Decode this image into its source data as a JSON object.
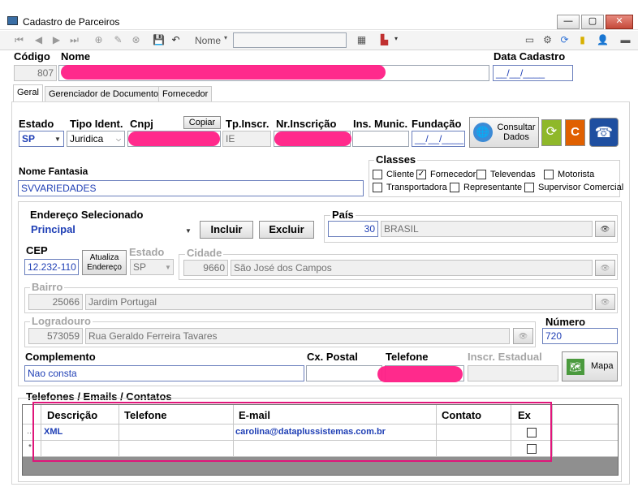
{
  "window": {
    "title": "Cadastro de Parceiros",
    "buttons": [
      "—",
      "▢",
      "✕"
    ]
  },
  "toolbar": {
    "nome_label": "Nome",
    "search_value": ""
  },
  "header": {
    "codigo_label": "Código",
    "codigo_value": "807",
    "nome_label": "Nome",
    "nome_value": "",
    "data_cadastro_label": "Data Cadastro",
    "data_cadastro_value": "__/__/____"
  },
  "tabs": [
    "Geral",
    "Gerenciador de Documentos",
    "Fornecedor"
  ],
  "geral": {
    "estado_label": "Estado",
    "estado_value": "SP",
    "tipo_ident_label": "Tipo Ident.",
    "tipo_ident_value": "Juridica",
    "cnpj_label": "Cnpj",
    "copiar_label": "Copiar",
    "tp_inscr_label": "Tp.Inscr.",
    "tp_inscr_value": "IE",
    "nr_inscricao_label": "Nr.Inscrição",
    "ins_munic_label": "Ins. Munic.",
    "fundacao_label": "Fundação",
    "fundacao_value": "__/__/____",
    "consultar_dados_label": "Consultar Dados",
    "nome_fantasia_label": "Nome Fantasia",
    "nome_fantasia_value": "SVVARIEDADES"
  },
  "classes": {
    "title": "Classes",
    "items": [
      {
        "label": "Cliente",
        "checked": false
      },
      {
        "label": "Fornecedor",
        "checked": true
      },
      {
        "label": "Televendas",
        "checked": false
      },
      {
        "label": "Motorista",
        "checked": false
      },
      {
        "label": "Transportadora",
        "checked": false
      },
      {
        "label": "Representante",
        "checked": false
      },
      {
        "label": "Supervisor Comercial",
        "checked": false
      }
    ]
  },
  "endereco": {
    "selecionado_label": "Endereço Selecionado",
    "selecionado_value": "Principal",
    "incluir_label": "Incluir",
    "excluir_label": "Excluir",
    "pais_label": "País",
    "pais_code": "30",
    "pais_name": "BRASIL",
    "cep_label": "CEP",
    "cep_value": "12.232-110",
    "atualiza_label": "Atualiza Endereço",
    "estado_label": "Estado",
    "estado_value": "SP",
    "cidade_label": "Cidade",
    "cidade_code": "9660",
    "cidade_name": "São José dos Campos",
    "bairro_label": "Bairro",
    "bairro_code": "25066",
    "bairro_name": "Jardim Portugal",
    "logradouro_label": "Logradouro",
    "logradouro_code": "573059",
    "logradouro_name": "Rua Geraldo Ferreira Tavares",
    "numero_label": "Número",
    "numero_value": "720",
    "complemento_label": "Complemento",
    "complemento_value": "Nao consta",
    "cx_postal_label": "Cx. Postal",
    "telefone_label": "Telefone",
    "inscr_estadual_label": "Inscr. Estadual",
    "mapa_label": "Mapa"
  },
  "contatos": {
    "title": "Telefones / Emails / Contatos",
    "columns": [
      "Descrição",
      "Telefone",
      "E-mail",
      "Contato",
      "Ex"
    ],
    "rows": [
      {
        "descricao": "XML",
        "telefone": "",
        "email": "carolina@dataplussistemas.com.br",
        "contato": ""
      },
      {
        "descricao": "",
        "telefone": "",
        "email": "",
        "contato": ""
      }
    ]
  },
  "colors": {
    "redaction": "#ff1f86",
    "highlight_border": "#e0157a",
    "value_blue": "#1f3fb5"
  }
}
